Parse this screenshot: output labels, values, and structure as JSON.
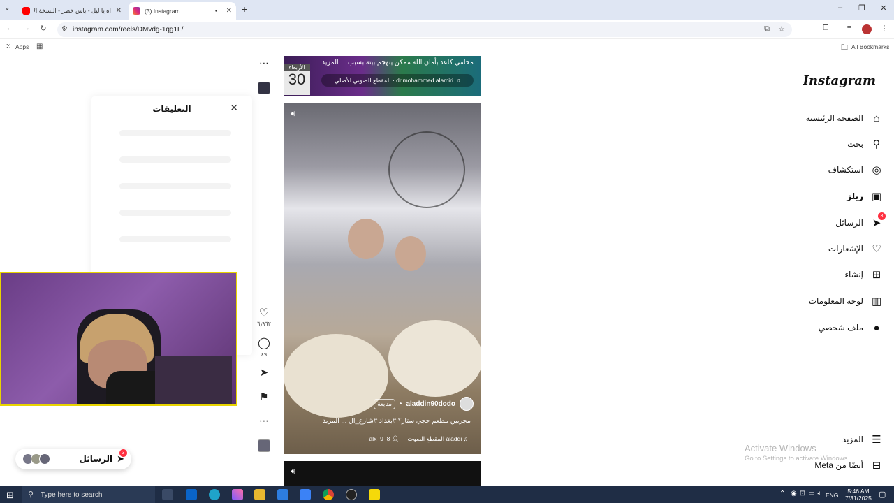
{
  "browser": {
    "tabs": [
      {
        "title": "اه يا ليل - ياس خضر - النسخة الأ",
        "active": false,
        "favicon_color": "#ff0000"
      },
      {
        "title": "(3) Instagram",
        "active": true,
        "favicon_color": "#d6249f"
      }
    ],
    "new_tab_label": "+",
    "url": "instagram.com/reels/DMvdg-1qg1L/",
    "bookmarks": {
      "apps_label": "Apps",
      "all_bookmarks_label": "All Bookmarks"
    }
  },
  "nav": {
    "logo": "Instagram",
    "items": [
      {
        "label": "الصفحة الرئيسية",
        "icon": "home-icon",
        "glyph": "⌂"
      },
      {
        "label": "بحث",
        "icon": "search-icon",
        "glyph": "⚲"
      },
      {
        "label": "استكشاف",
        "icon": "compass-icon",
        "glyph": "◎"
      },
      {
        "label": "ريلز",
        "icon": "reels-icon",
        "glyph": "▣"
      },
      {
        "label": "الرسائل",
        "icon": "messenger-icon",
        "glyph": "➤",
        "badge": "3"
      },
      {
        "label": "الإشعارات",
        "icon": "heart-icon",
        "glyph": "♡"
      },
      {
        "label": "إنشاء",
        "icon": "plus-square-icon",
        "glyph": "⊞"
      },
      {
        "label": "لوحة المعلومات",
        "icon": "chart-icon",
        "glyph": "▥"
      },
      {
        "label": "ملف شخصي",
        "icon": "avatar-icon",
        "glyph": "●"
      }
    ],
    "more_label": "المزيد",
    "meta_label": "أيضًا من Meta"
  },
  "comments": {
    "title": "التعليقات",
    "close": "✕"
  },
  "reel_top": {
    "caption": "محامي كاعد بأمان الله ممكن ينهجم بيته بسبب ... المزيد",
    "audio": "dr.mohammed.alamiri · المقطع الصوتي الأصلي",
    "date_number": "30",
    "date_label": "الأربعاء"
  },
  "reel_main": {
    "username": "aladdin90dodo",
    "follow_label": "متابعة",
    "caption": "مجربين مطعم حجي ستار؟ #بغداد #شارع_ال ... المزيد",
    "audio": "aladdi المقطع الصوت",
    "tagged_user": "alx_9_8",
    "like_count": "٦٫٩٦٢",
    "comment_count": "٤٩"
  },
  "messages_pill": {
    "label": "الرسائل",
    "badge": "3"
  },
  "watermark": {
    "line1": "Activate Windows",
    "line2": "Go to Settings to activate Windows."
  },
  "taskbar": {
    "search_placeholder": "Type here to search",
    "lang": "ENG",
    "time": "5:46 AM",
    "date": "7/31/2025"
  }
}
